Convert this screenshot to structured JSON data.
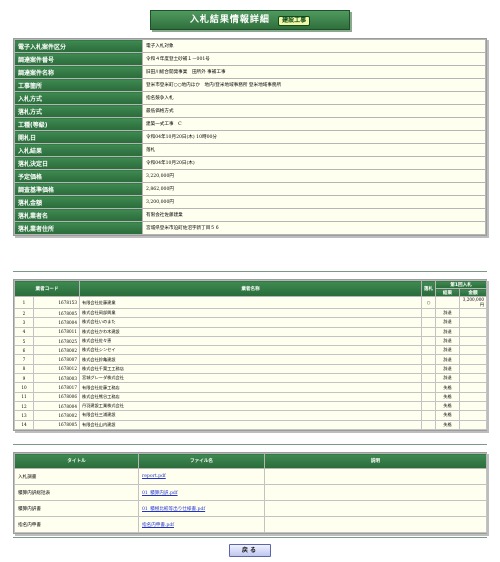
{
  "header": {
    "title": "入札結果情報詳細",
    "badge": "建設工事"
  },
  "info": [
    {
      "label": "電子入札案件区分",
      "value": "電子入札対象"
    },
    {
      "label": "調達案件番号",
      "value": "令和４年度登土砂補１－001号"
    },
    {
      "label": "調達案件名称",
      "value": "旧田川総合開発事業　田所外 事補工事"
    },
    {
      "label": "工事箇所",
      "value": "登米市登米町○○地内ほか　地内/登米地域事務所 登米地域事務所"
    },
    {
      "label": "入札方式",
      "value": "指名競争入札"
    },
    {
      "label": "落札方式",
      "value": "最低価格方式"
    },
    {
      "label": "工種(等級)",
      "value": "建築一式工事　C"
    },
    {
      "label": "開札日",
      "value": "令和04年10月20日(木) 10時00分"
    },
    {
      "label": "入札結果",
      "value": "落札"
    },
    {
      "label": "落札決定日",
      "value": "令和04年10月20日(木)"
    },
    {
      "label": "予定価格",
      "value": "3,220,000円"
    },
    {
      "label": "調査基準価格",
      "value": "2,862,000円"
    },
    {
      "label": "落札金額",
      "value": "3,200,000円"
    },
    {
      "label": "落札業者名",
      "value": "有限会社佐藤建業"
    },
    {
      "label": "落札業者住所",
      "value": "宮城県登米市迫町佐沼字新丁目５６"
    }
  ],
  "bidders": {
    "headers": {
      "code": "業者コード",
      "name": "業者名称",
      "winner": "落札",
      "round1": "第1回入札",
      "result": "結果",
      "amount": "金額"
    },
    "rows": [
      {
        "no": "1",
        "code": "1678153",
        "name": "有限会社佐藤建業",
        "winner": "○",
        "result": "",
        "amount": "3,200,000円"
      },
      {
        "no": "2",
        "code": "1678005",
        "name": "株式会社岡部興業",
        "winner": "",
        "result": "辞退",
        "amount": ""
      },
      {
        "no": "3",
        "code": "1678004",
        "name": "株式会社いのまた",
        "winner": "",
        "result": "辞退",
        "amount": ""
      },
      {
        "no": "4",
        "code": "1678011",
        "name": "株式会社かわ木建設",
        "winner": "",
        "result": "辞退",
        "amount": ""
      },
      {
        "no": "5",
        "code": "1678025",
        "name": "株式会社佐々恵",
        "winner": "",
        "result": "辞退",
        "amount": ""
      },
      {
        "no": "6",
        "code": "1678002",
        "name": "株式会社シンセイ",
        "winner": "",
        "result": "辞退",
        "amount": ""
      },
      {
        "no": "7",
        "code": "1678007",
        "name": "株式会社鈴亀建設",
        "winner": "",
        "result": "辞退",
        "amount": ""
      },
      {
        "no": "8",
        "code": "1678012",
        "name": "株式会社千葉工工務店",
        "winner": "",
        "result": "辞退",
        "amount": ""
      },
      {
        "no": "9",
        "code": "1678003",
        "name": "宮城グレーダ株式会社",
        "winner": "",
        "result": "辞退",
        "amount": ""
      },
      {
        "no": "10",
        "code": "1678017",
        "name": "有限会社佐藤工務店",
        "winner": "",
        "result": "失格",
        "amount": ""
      },
      {
        "no": "11",
        "code": "1678006",
        "name": "株式会社熊谷工務店",
        "winner": "",
        "result": "失格",
        "amount": ""
      },
      {
        "no": "12",
        "code": "1678004",
        "name": "丹羽建設工業株式会社",
        "winner": "",
        "result": "失格",
        "amount": ""
      },
      {
        "no": "13",
        "code": "1678002",
        "name": "有限会社三浦建設",
        "winner": "",
        "result": "失格",
        "amount": ""
      },
      {
        "no": "14",
        "code": "1678005",
        "name": "有限会社山内建設",
        "winner": "",
        "result": "失格",
        "amount": ""
      }
    ]
  },
  "files": {
    "headers": {
      "title": "タイトル",
      "filename": "ファイル名",
      "description": "説明"
    },
    "rows": [
      {
        "title": "入札調書",
        "file": "report.pdf"
      },
      {
        "title": "積算内訳総括表",
        "file": "01_積算内訳.pdf"
      },
      {
        "title": "積算内訳書",
        "file": "01_積極比較等出り仕様書.pdf"
      },
      {
        "title": "指名内申書",
        "file": "指名内申書.pdf"
      }
    ]
  },
  "footer": {
    "back_label": "戻る"
  }
}
